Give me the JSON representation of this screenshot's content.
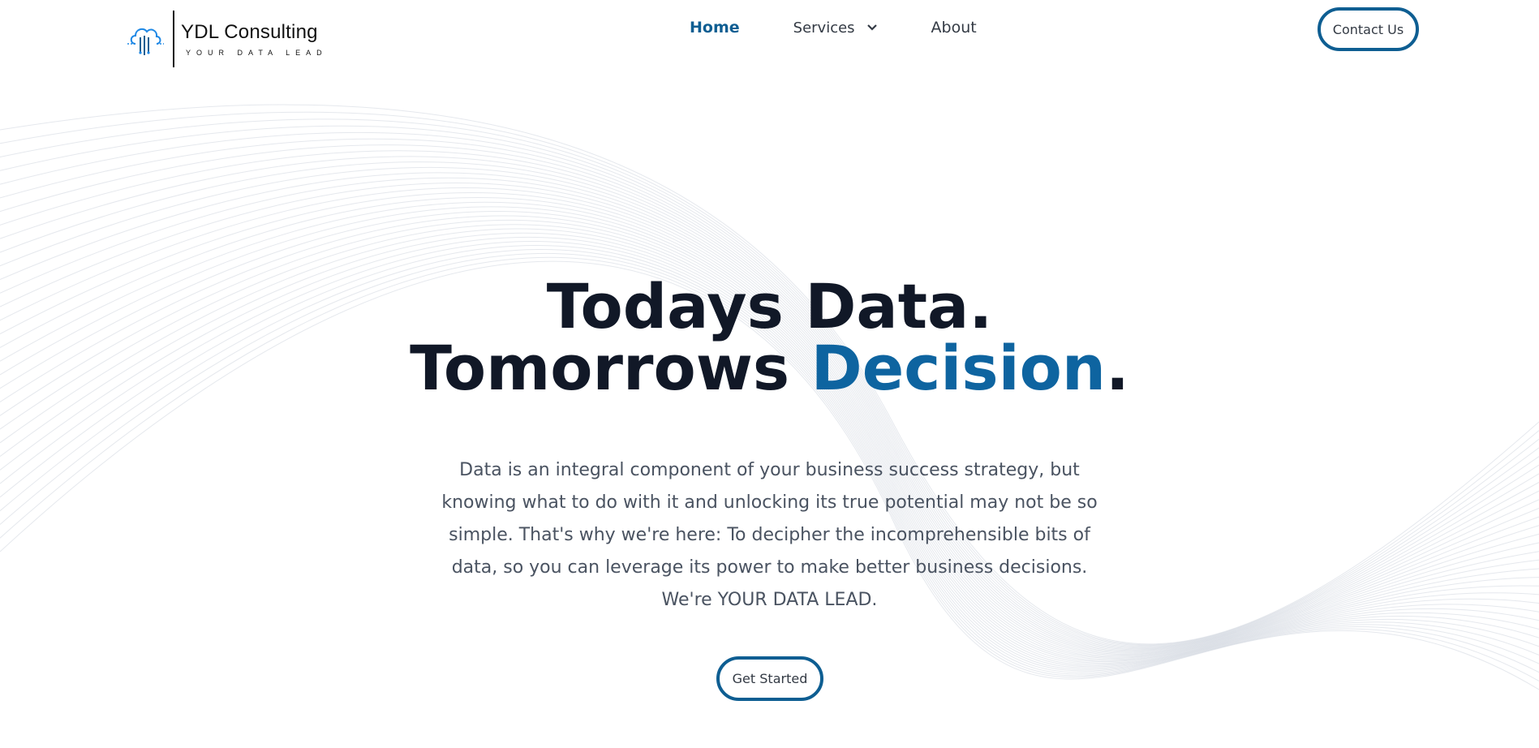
{
  "brand": {
    "name": "YDL Consulting",
    "tagline": "YOUR DATA LEAD",
    "logo_icon": "cloud-circuit-icon"
  },
  "nav": {
    "home": "Home",
    "services": "Services",
    "about": "About",
    "services_icon": "chevron-down-icon",
    "contact": "Contact Us"
  },
  "hero": {
    "line1": "Todays Data.",
    "line2_main": "Tomorrows ",
    "line2_accent": "Decision",
    "line2_end": ".",
    "description": "Data is an integral component of your business success strategy, but knowing what to do with it and unlocking its true potential may not be so simple. That's why we're here: To decipher the incomprehensible bits of data, so you can leverage its power to make better business decisions. We're YOUR DATA LEAD.",
    "cta": "Get Started"
  },
  "colors": {
    "accent": "#0e64a0",
    "button_border": "#0e5e92",
    "heading": "#111827",
    "body_text": "#4a5361"
  }
}
